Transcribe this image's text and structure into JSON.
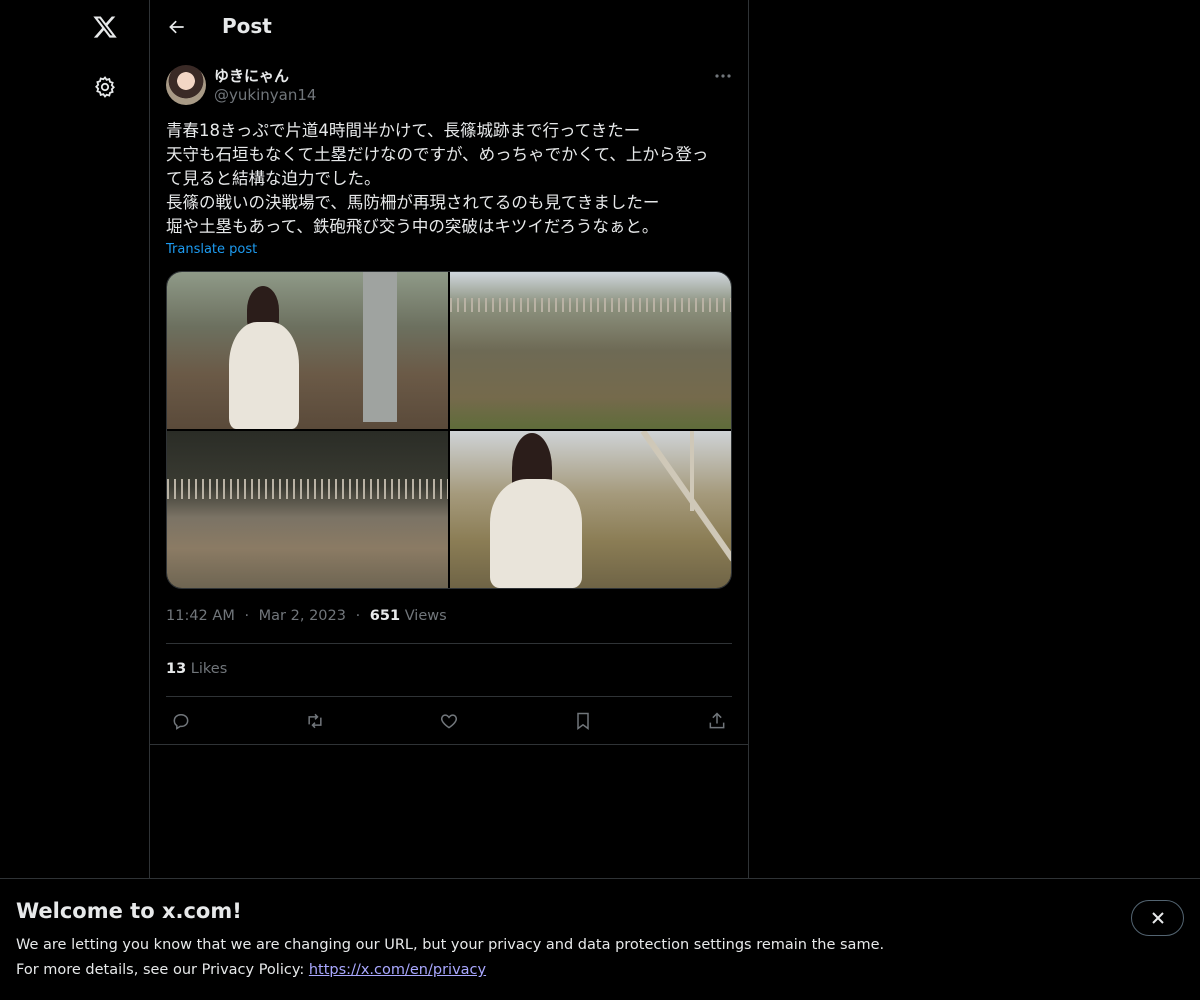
{
  "nav": {
    "logo_icon": "x-logo-icon",
    "settings_icon": "gear-icon"
  },
  "header": {
    "title": "Post",
    "back_icon": "arrow-left-icon"
  },
  "post": {
    "author_name": "ゆきにゃん",
    "author_handle": "@yukinyan14",
    "text_lines": [
      "青春18きっぷで片道4時間半かけて、長篠城跡まで行ってきたー",
      "天守も石垣もなくて土塁だけなのですが、めっちゃでかくて、上から登っ",
      "て見ると結構な迫力でした。",
      "長篠の戦いの決戦場で、馬防柵が再現されてるのも見てきましたー",
      "堀や土塁もあって、鉄砲飛び交う中の突破はキツイだろうなぁと。"
    ],
    "translate_label": "Translate post",
    "time": "11:42 AM",
    "separator": "·",
    "date": "Mar 2, 2023",
    "views_count": "651",
    "views_label": "Views",
    "likes_count": "13",
    "likes_label": "Likes"
  },
  "actions": {
    "reply_icon": "reply-icon",
    "repost_icon": "repost-icon",
    "like_icon": "heart-icon",
    "bookmark_icon": "bookmark-icon",
    "share_icon": "share-icon"
  },
  "banner": {
    "title": "Welcome to x.com!",
    "line1": "We are letting you know that we are changing our URL, but your privacy and data protection settings remain the same.",
    "line2_prefix": "For more details, see our Privacy Policy: ",
    "link_text": "https://x.com/en/privacy",
    "close_icon": "close-icon"
  },
  "colors": {
    "background": "#000000",
    "text": "#e7e9ea",
    "muted": "#71767b",
    "accent": "#1d9bf0",
    "border": "#2f3336",
    "link": "#a9a8ff"
  }
}
